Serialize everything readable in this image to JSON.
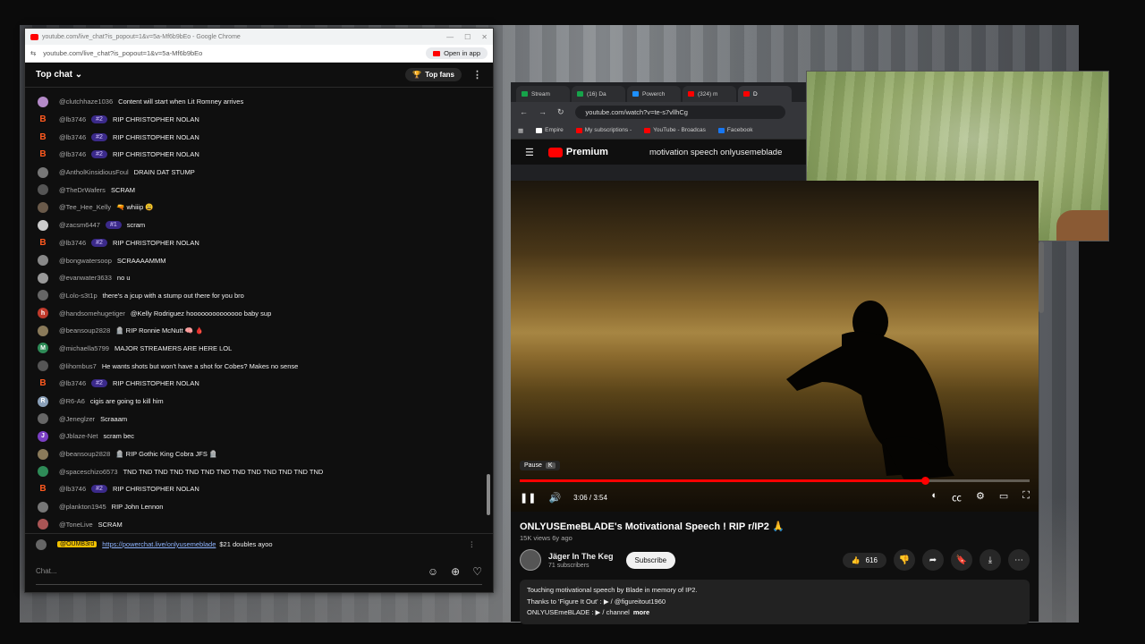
{
  "chat_window": {
    "title_url": "youtube.com/live_chat?is_popout=1&v=5a-Mf6b9bEo - Google Chrome",
    "url": "youtube.com/live_chat?is_popout=1&v=5a-Mf6b9bEo",
    "open_in_app": "Open in app",
    "header": "Top chat",
    "top_fans": "Top fans",
    "messages": [
      {
        "author": "@clutchhaze1036",
        "badge": "",
        "text": "Content will start when Lit Romney arrives",
        "avatar": "",
        "avatar_color": "#b48ac8"
      },
      {
        "author": "@lb3746",
        "badge": "#2",
        "text": "RIP CHRISTOPHER NOLAN",
        "avatar": "B",
        "avatar_color": ""
      },
      {
        "author": "@lb3746",
        "badge": "#2",
        "text": "RIP CHRISTOPHER NOLAN",
        "avatar": "B",
        "avatar_color": ""
      },
      {
        "author": "@lb3746",
        "badge": "#2",
        "text": "RIP CHRISTOPHER NOLAN",
        "avatar": "B",
        "avatar_color": ""
      },
      {
        "author": "@AntholKinsidiousFoul",
        "badge": "",
        "text": "DRAIN DAT STUMP",
        "avatar": "",
        "avatar_color": "#777"
      },
      {
        "author": "@TheDrWafers",
        "badge": "",
        "text": "SCRAM",
        "avatar": "",
        "avatar_color": "#555"
      },
      {
        "author": "@Tee_Hee_Kelly",
        "badge": "",
        "text": "🔫 whiiip 😩",
        "avatar": "",
        "avatar_color": "#6a5a4a"
      },
      {
        "author": "@zacsm6447",
        "badge": "#1",
        "text": "scram",
        "avatar": "",
        "avatar_color": "#ccc"
      },
      {
        "author": "@lb3746",
        "badge": "#2",
        "text": "RIP CHRISTOPHER NOLAN",
        "avatar": "B",
        "avatar_color": ""
      },
      {
        "author": "@bongwatersoop",
        "badge": "",
        "text": "SCRAAAAMMM",
        "avatar": "",
        "avatar_color": "#888"
      },
      {
        "author": "@evanwater3633",
        "badge": "",
        "text": "no u",
        "avatar": "",
        "avatar_color": "#999"
      },
      {
        "author": "@Lolo-s3t1p",
        "badge": "",
        "text": "there's a jcup with a stump out there for you bro",
        "avatar": "",
        "avatar_color": "#666"
      },
      {
        "author": "@handsomehugetiger",
        "badge": "",
        "text": "@Kelly Rodriguez hoooooooooooooo baby sup",
        "avatar": "h",
        "avatar_color": "#c0392b"
      },
      {
        "author": "@beansoup2828",
        "badge": "",
        "text": "🪦 RIP Ronnie McNutt 🧠 🩸",
        "avatar": "",
        "avatar_color": "#8a7a5a"
      },
      {
        "author": "@michaella5799",
        "badge": "",
        "text": "MAJOR STREAMERS ARE HERE LOL",
        "avatar": "M",
        "avatar_color": "#2e8b57"
      },
      {
        "author": "@lihombus7",
        "badge": "",
        "text": "He wants shots but won't have a shot for Cobes? Makes no sense",
        "avatar": "",
        "avatar_color": "#555"
      },
      {
        "author": "@lb3746",
        "badge": "#2",
        "text": "RIP CHRISTOPHER NOLAN",
        "avatar": "B",
        "avatar_color": ""
      },
      {
        "author": "@R6-A6",
        "badge": "",
        "text": "cigis are going to kill him",
        "avatar": "R",
        "avatar_color": "#8aa0b8"
      },
      {
        "author": "@Jeneglzer",
        "badge": "",
        "text": "Scraaam",
        "avatar": "",
        "avatar_color": "#666"
      },
      {
        "author": "@Jblaze-Net",
        "badge": "",
        "text": "scram bec",
        "avatar": "J",
        "avatar_color": "#7b3fc4"
      },
      {
        "author": "@beansoup2828",
        "badge": "",
        "text": "🪦 RIP Gothic King Cobra JFS 🪦",
        "avatar": "",
        "avatar_color": "#8a7a5a"
      },
      {
        "author": "@spaceschizo6573",
        "badge": "",
        "text": "TND TND TND TND TND TND TND TND TND TND TND TND TND",
        "avatar": "",
        "avatar_color": "#2e8b57"
      },
      {
        "author": "@lb3746",
        "badge": "#2",
        "text": "RIP CHRISTOPHER NOLAN",
        "avatar": "B",
        "avatar_color": ""
      },
      {
        "author": "@plankton1945",
        "badge": "",
        "text": "RIP John Lennon",
        "avatar": "",
        "avatar_color": "#777"
      },
      {
        "author": "@ToneLive",
        "badge": "",
        "text": "SCRAM",
        "avatar": "",
        "avatar_color": "#a55"
      }
    ],
    "pinned": {
      "author": "@OUMB3rd",
      "link": "https://powerchat.live/onlyusemeblade",
      "text": "$21 doubles ayoo"
    },
    "chat_placeholder": "Chat..."
  },
  "browser": {
    "tabs": [
      {
        "label": "Stream",
        "color": "#16a34a"
      },
      {
        "label": "(16) Da",
        "color": "#16a34a"
      },
      {
        "label": "Powerch",
        "color": "#1e90ff"
      },
      {
        "label": "(324) m",
        "color": "#ff0000"
      },
      {
        "label": "D",
        "color": "#ff0000"
      }
    ],
    "url": "youtube.com/watch?v=te-s7vllhCg",
    "bookmarks": [
      {
        "label": "Empire",
        "color": "#ffffff"
      },
      {
        "label": "My subscriptions -",
        "color": "#ff0000"
      },
      {
        "label": "YouTube - Broadcas",
        "color": "#ff0000"
      },
      {
        "label": "Facebook",
        "color": "#1877f2"
      }
    ],
    "logo": "Premium",
    "search_query": "motivation speech onlyusemeblade"
  },
  "player": {
    "pause_tip": "Pause",
    "pause_key": "K",
    "time": "3:06 / 3:54",
    "progress": 0.795
  },
  "video": {
    "title": "ONLYUSEmeBLADE's Motivational Speech ! RIP r/IP2 🙏",
    "views": "15K views  6y ago",
    "channel": "Jäger In The Keg",
    "subscribers": "71 subscribers",
    "subscribe": "Subscribe",
    "likes": "616",
    "desc_line1": "Touching motivational speech by Blade in memory of IP2.",
    "desc_line2": "Thanks to 'Figure It Out' :  ▶ / @figureitout1960",
    "desc_line3": "ONLYUSEmeBLADE :  ▶ / channel",
    "more": "more"
  }
}
